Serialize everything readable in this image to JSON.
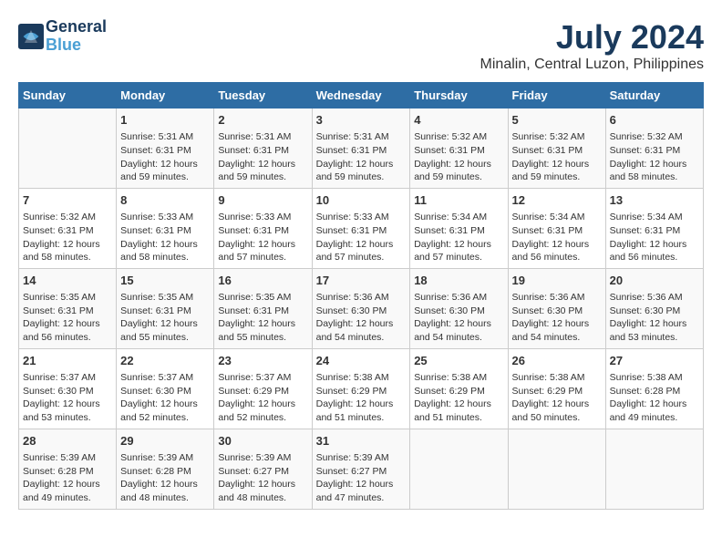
{
  "header": {
    "logo_line1": "General",
    "logo_line2": "Blue",
    "month": "July 2024",
    "location": "Minalin, Central Luzon, Philippines"
  },
  "weekdays": [
    "Sunday",
    "Monday",
    "Tuesday",
    "Wednesday",
    "Thursday",
    "Friday",
    "Saturday"
  ],
  "weeks": [
    [
      {
        "day": "",
        "info": ""
      },
      {
        "day": "1",
        "info": "Sunrise: 5:31 AM\nSunset: 6:31 PM\nDaylight: 12 hours\nand 59 minutes."
      },
      {
        "day": "2",
        "info": "Sunrise: 5:31 AM\nSunset: 6:31 PM\nDaylight: 12 hours\nand 59 minutes."
      },
      {
        "day": "3",
        "info": "Sunrise: 5:31 AM\nSunset: 6:31 PM\nDaylight: 12 hours\nand 59 minutes."
      },
      {
        "day": "4",
        "info": "Sunrise: 5:32 AM\nSunset: 6:31 PM\nDaylight: 12 hours\nand 59 minutes."
      },
      {
        "day": "5",
        "info": "Sunrise: 5:32 AM\nSunset: 6:31 PM\nDaylight: 12 hours\nand 59 minutes."
      },
      {
        "day": "6",
        "info": "Sunrise: 5:32 AM\nSunset: 6:31 PM\nDaylight: 12 hours\nand 58 minutes."
      }
    ],
    [
      {
        "day": "7",
        "info": "Sunrise: 5:32 AM\nSunset: 6:31 PM\nDaylight: 12 hours\nand 58 minutes."
      },
      {
        "day": "8",
        "info": "Sunrise: 5:33 AM\nSunset: 6:31 PM\nDaylight: 12 hours\nand 58 minutes."
      },
      {
        "day": "9",
        "info": "Sunrise: 5:33 AM\nSunset: 6:31 PM\nDaylight: 12 hours\nand 57 minutes."
      },
      {
        "day": "10",
        "info": "Sunrise: 5:33 AM\nSunset: 6:31 PM\nDaylight: 12 hours\nand 57 minutes."
      },
      {
        "day": "11",
        "info": "Sunrise: 5:34 AM\nSunset: 6:31 PM\nDaylight: 12 hours\nand 57 minutes."
      },
      {
        "day": "12",
        "info": "Sunrise: 5:34 AM\nSunset: 6:31 PM\nDaylight: 12 hours\nand 56 minutes."
      },
      {
        "day": "13",
        "info": "Sunrise: 5:34 AM\nSunset: 6:31 PM\nDaylight: 12 hours\nand 56 minutes."
      }
    ],
    [
      {
        "day": "14",
        "info": "Sunrise: 5:35 AM\nSunset: 6:31 PM\nDaylight: 12 hours\nand 56 minutes."
      },
      {
        "day": "15",
        "info": "Sunrise: 5:35 AM\nSunset: 6:31 PM\nDaylight: 12 hours\nand 55 minutes."
      },
      {
        "day": "16",
        "info": "Sunrise: 5:35 AM\nSunset: 6:31 PM\nDaylight: 12 hours\nand 55 minutes."
      },
      {
        "day": "17",
        "info": "Sunrise: 5:36 AM\nSunset: 6:30 PM\nDaylight: 12 hours\nand 54 minutes."
      },
      {
        "day": "18",
        "info": "Sunrise: 5:36 AM\nSunset: 6:30 PM\nDaylight: 12 hours\nand 54 minutes."
      },
      {
        "day": "19",
        "info": "Sunrise: 5:36 AM\nSunset: 6:30 PM\nDaylight: 12 hours\nand 54 minutes."
      },
      {
        "day": "20",
        "info": "Sunrise: 5:36 AM\nSunset: 6:30 PM\nDaylight: 12 hours\nand 53 minutes."
      }
    ],
    [
      {
        "day": "21",
        "info": "Sunrise: 5:37 AM\nSunset: 6:30 PM\nDaylight: 12 hours\nand 53 minutes."
      },
      {
        "day": "22",
        "info": "Sunrise: 5:37 AM\nSunset: 6:30 PM\nDaylight: 12 hours\nand 52 minutes."
      },
      {
        "day": "23",
        "info": "Sunrise: 5:37 AM\nSunset: 6:29 PM\nDaylight: 12 hours\nand 52 minutes."
      },
      {
        "day": "24",
        "info": "Sunrise: 5:38 AM\nSunset: 6:29 PM\nDaylight: 12 hours\nand 51 minutes."
      },
      {
        "day": "25",
        "info": "Sunrise: 5:38 AM\nSunset: 6:29 PM\nDaylight: 12 hours\nand 51 minutes."
      },
      {
        "day": "26",
        "info": "Sunrise: 5:38 AM\nSunset: 6:29 PM\nDaylight: 12 hours\nand 50 minutes."
      },
      {
        "day": "27",
        "info": "Sunrise: 5:38 AM\nSunset: 6:28 PM\nDaylight: 12 hours\nand 49 minutes."
      }
    ],
    [
      {
        "day": "28",
        "info": "Sunrise: 5:39 AM\nSunset: 6:28 PM\nDaylight: 12 hours\nand 49 minutes."
      },
      {
        "day": "29",
        "info": "Sunrise: 5:39 AM\nSunset: 6:28 PM\nDaylight: 12 hours\nand 48 minutes."
      },
      {
        "day": "30",
        "info": "Sunrise: 5:39 AM\nSunset: 6:27 PM\nDaylight: 12 hours\nand 48 minutes."
      },
      {
        "day": "31",
        "info": "Sunrise: 5:39 AM\nSunset: 6:27 PM\nDaylight: 12 hours\nand 47 minutes."
      },
      {
        "day": "",
        "info": ""
      },
      {
        "day": "",
        "info": ""
      },
      {
        "day": "",
        "info": ""
      }
    ]
  ]
}
